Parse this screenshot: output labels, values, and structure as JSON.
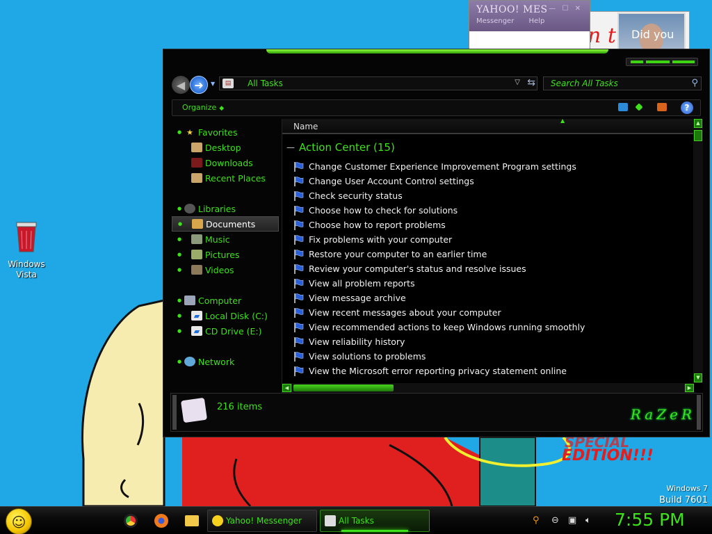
{
  "colors": {
    "desktop_bg": "#1fa7e6",
    "accent_green": "#3ee21a",
    "window_bg": "#050505"
  },
  "desktop": {
    "icons": [
      {
        "label_line1": "Windows",
        "label_line2": "Vista",
        "icon": "recycle-bin-icon"
      }
    ],
    "wallpaper_text": "EDITION!!!",
    "wallpaper_text_partial": "SPECIAL",
    "scrawl_text": "n t"
  },
  "yahoo_window": {
    "title": "YAHOO! MES",
    "menu": [
      "Messenger",
      "Help"
    ],
    "photo_caption": "Did you"
  },
  "explorer": {
    "address": "All Tasks",
    "search_placeholder": "Search All Tasks",
    "organize_label": "Organize",
    "nav": {
      "favorites": {
        "label": "Favorites",
        "items": [
          "Desktop",
          "Downloads",
          "Recent Places"
        ]
      },
      "libraries": {
        "label": "Libraries",
        "items": [
          "Documents",
          "Music",
          "Pictures",
          "Videos"
        ]
      },
      "computer": {
        "label": "Computer",
        "items": [
          "Local Disk (C:)",
          "CD Drive (E:)"
        ]
      },
      "network": {
        "label": "Network"
      }
    },
    "column_header": "Name",
    "group": {
      "title": "Action Center (15)",
      "tasks": [
        "Change Customer Experience Improvement Program settings",
        "Change User Account Control settings",
        "Check security status",
        "Choose how to check for solutions",
        "Choose how to report problems",
        "Fix problems with your computer",
        "Restore your computer to an earlier time",
        "Review your computer's status and resolve issues",
        "View all problem reports",
        "View message archive",
        "View recent messages about your computer",
        "View recommended actions to keep Windows running smoothly",
        "View reliability history",
        "View solutions to problems",
        "View the Microsoft error reporting privacy statement online"
      ]
    },
    "item_count": "216 items",
    "brand_logo": "RaZeR"
  },
  "watermark": {
    "line1": "Windows 7",
    "line2": "Build 7601"
  },
  "taskbar": {
    "buttons": [
      {
        "label": "Yahoo! Messenger",
        "icon": "yahoo-smiley-icon"
      },
      {
        "label": "All Tasks",
        "icon": "control-panel-icon"
      }
    ],
    "quick_launch": [
      "chrome-icon",
      "firefox-icon",
      "folder-icon"
    ],
    "tray": [
      "search-icon",
      "status-icon",
      "network-icon",
      "volume-icon"
    ],
    "clock": "7:55 PM"
  }
}
